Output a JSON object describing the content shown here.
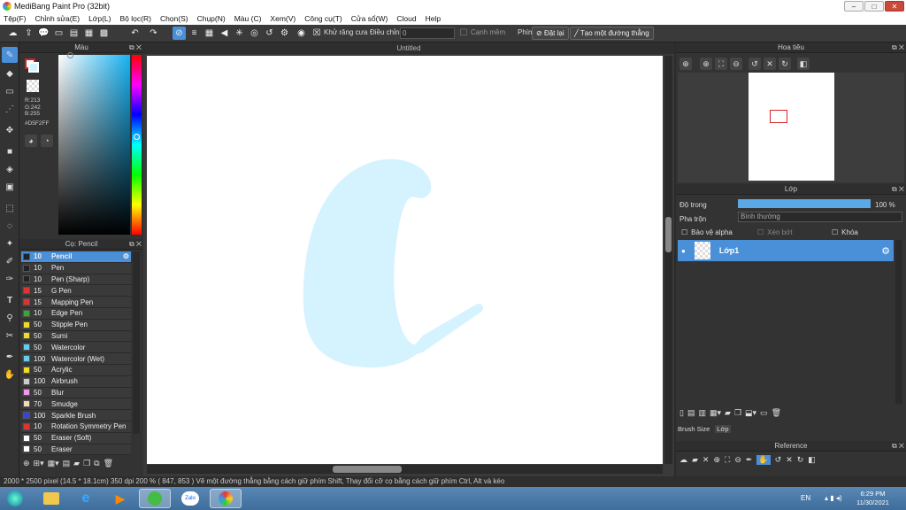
{
  "window": {
    "title": "MediBang Paint Pro (32bit)"
  },
  "menu": [
    "Tệp(F)",
    "Chỉnh sửa(E)",
    "Lớp(L)",
    "Bộ lọc(R)",
    "Chọn(S)",
    "Chụp(N)",
    "Màu (C)",
    "Xem(V)",
    "Công cụ(T)",
    "Cửa sổ(W)",
    "Cloud",
    "Help"
  ],
  "toolbar": {
    "antialias_label": "Khử răng cưa",
    "adjust_label": "Điều chỉnh",
    "adjust_value": "0",
    "edge_label": "Cạnh mềm",
    "key_label": "Phím",
    "reset_label": "Đặt lại",
    "line_label": "Tạo một đường thẳng"
  },
  "color_panel": {
    "title": "Màu",
    "r": "R:213",
    "g": "G:242",
    "b": "B:255",
    "hex": "#D5F2FF",
    "primary_color": "#D5F2FF",
    "accent": "#CC2222"
  },
  "brush_panel": {
    "title": "Cọ: Pencil",
    "brushes": [
      {
        "size": "10",
        "name": "Pencil",
        "color": "#222222"
      },
      {
        "size": "10",
        "name": "Pen",
        "color": "#222222"
      },
      {
        "size": "10",
        "name": "Pen (Sharp)",
        "color": "#222222"
      },
      {
        "size": "15",
        "name": "G Pen",
        "color": "#dd3333"
      },
      {
        "size": "15",
        "name": "Mapping Pen",
        "color": "#dd3333"
      },
      {
        "size": "10",
        "name": "Edge Pen",
        "color": "#33aa33"
      },
      {
        "size": "50",
        "name": "Stipple Pen",
        "color": "#eedd22"
      },
      {
        "size": "50",
        "name": "Sumi",
        "color": "#eedd22"
      },
      {
        "size": "50",
        "name": "Watercolor",
        "color": "#66ccee"
      },
      {
        "size": "100",
        "name": "Watercolor (Wet)",
        "color": "#66ccee"
      },
      {
        "size": "50",
        "name": "Acrylic",
        "color": "#eedd22"
      },
      {
        "size": "100",
        "name": "Airbrush",
        "color": "#cccccc"
      },
      {
        "size": "50",
        "name": "Blur",
        "color": "#ee99ee"
      },
      {
        "size": "70",
        "name": "Smudge",
        "color": "#f5d9b8"
      },
      {
        "size": "100",
        "name": "Sparkle Brush",
        "color": "#3344dd"
      },
      {
        "size": "10",
        "name": "Rotation Symmetry Pen",
        "color": "#dd3333"
      },
      {
        "size": "50",
        "name": "Eraser (Soft)",
        "color": "#ffffff"
      },
      {
        "size": "50",
        "name": "Eraser",
        "color": "#ffffff"
      }
    ]
  },
  "canvas": {
    "title": "Untitled",
    "stroke_color": "#D5F2FF"
  },
  "navigator": {
    "title": "Hoa tiêu"
  },
  "layer_panel": {
    "title": "Lớp",
    "opacity_label": "Độ trong",
    "opacity_value": "100 %",
    "opacity_percent": 100,
    "blend_label": "Pha trộn",
    "blend_value": "Bình thường",
    "alpha_label": "Bảo vệ alpha",
    "clip_label": "Xén bớt",
    "lock_label": "Khóa",
    "layer_name": "Lớp1",
    "tab_brush_size": "Brush Size",
    "tab_layer": "Lớp"
  },
  "reference": {
    "title": "Reference"
  },
  "status": {
    "text": "2000 * 2500 pixel   (14.5 * 18.1cm)   350 dpi   200 %   ( 847, 853 )   Vẽ một đường thẳng bằng cách giữ phím Shift, Thay đổi cỡ cọ bằng cách giữ phím Ctrl, Alt và kéo"
  },
  "taskbar": {
    "lang": "EN",
    "time": "6:29 PM",
    "date": "11/30/2021"
  }
}
